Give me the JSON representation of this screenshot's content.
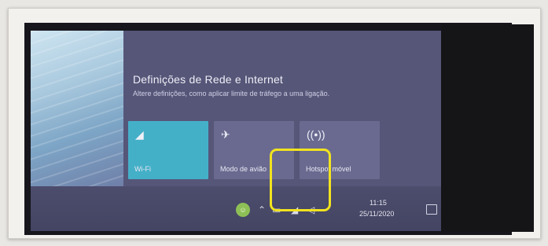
{
  "flyout": {
    "title": "Definições de Rede e Internet",
    "subtitle": "Altere definições, como aplicar limite de tráfego a uma ligação."
  },
  "tiles": [
    {
      "label": "Wi-Fi",
      "icon": "wifi-icon",
      "state": "on"
    },
    {
      "label": "Modo de avião",
      "icon": "airplane-icon",
      "state": "off"
    },
    {
      "label": "Hotspot móvel",
      "icon": "hotspot-icon",
      "state": "off"
    }
  ],
  "taskbar": {
    "time": "11:15",
    "date": "25/11/2020",
    "tray_icons": [
      "avatar-icon",
      "chevron-up-icon",
      "battery-icon",
      "network-icon",
      "volume-icon",
      "notification-icon"
    ]
  },
  "colors": {
    "accent": "#44b0c8",
    "flyout_bg": "#565679",
    "highlight": "#f1e31f"
  }
}
